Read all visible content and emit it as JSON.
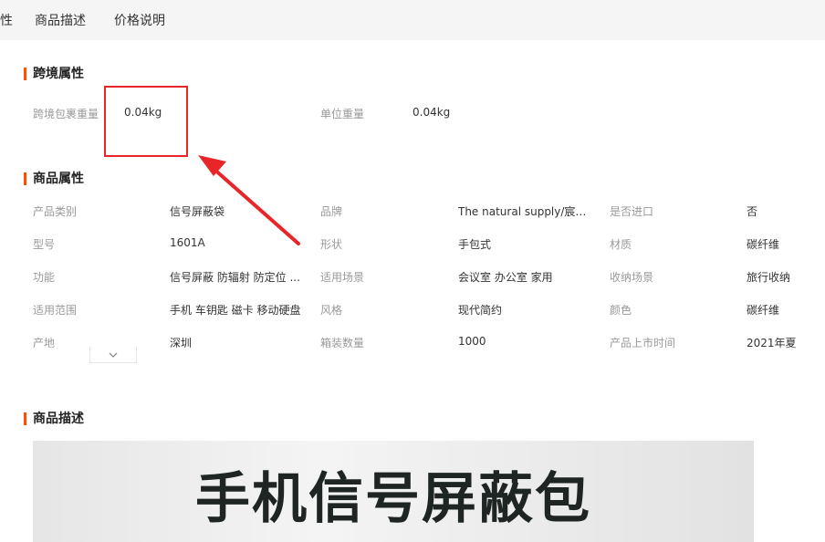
{
  "tabs": [
    "性",
    "商品描述",
    "价格说明"
  ],
  "cross_border": {
    "title": "跨境属性",
    "rows": [
      {
        "label": "跨境包裹重量",
        "value": "0.04kg"
      },
      {
        "label": "单位重量",
        "value": "0.04kg"
      }
    ]
  },
  "product_attrs": {
    "title": "商品属性",
    "rows": [
      [
        {
          "label": "产品类别",
          "value": "信号屏蔽袋"
        },
        {
          "label": "品牌",
          "value": "The natural supply/宸富..."
        },
        {
          "label": "是否进口",
          "value": "否"
        }
      ],
      [
        {
          "label": "型号",
          "value": "1601A"
        },
        {
          "label": "形状",
          "value": "手包式"
        },
        {
          "label": "材质",
          "value": "碳纤维"
        }
      ],
      [
        {
          "label": "功能",
          "value": "信号屏蔽 防辐射 防定位 ..."
        },
        {
          "label": "适用场景",
          "value": "会议室 办公室 家用"
        },
        {
          "label": "收纳场景",
          "value": "旅行收纳"
        }
      ],
      [
        {
          "label": "适用范围",
          "value": "手机 车钥匙 磁卡 移动硬盘"
        },
        {
          "label": "风格",
          "value": "现代简约"
        },
        {
          "label": "颜色",
          "value": "碳纤维"
        }
      ],
      [
        {
          "label": "产地",
          "value": "深圳"
        },
        {
          "label": "箱装数量",
          "value": "1000"
        },
        {
          "label": "产品上市时间",
          "value": "2021年夏"
        }
      ]
    ]
  },
  "description": {
    "title": "商品描述",
    "banner_text": "手机信号屏蔽包"
  },
  "colors": {
    "accent": "#ff5000",
    "annotation": "#e8262a"
  },
  "icons": {
    "expand": "chevron-down-icon"
  }
}
